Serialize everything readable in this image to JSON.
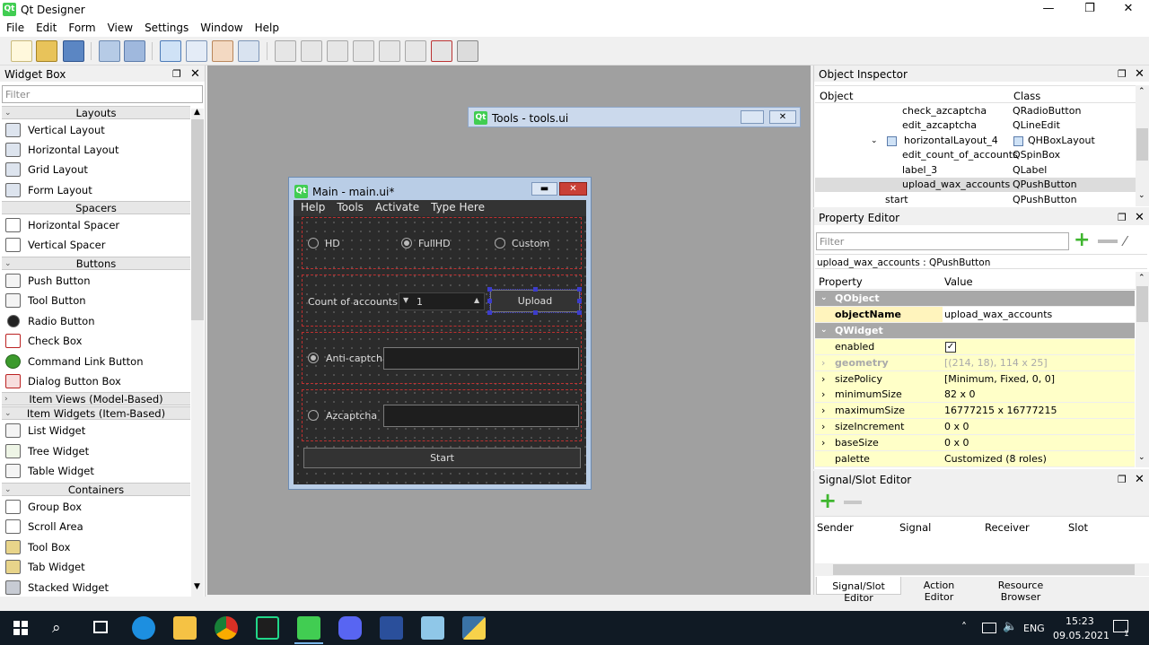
{
  "app": {
    "title": "Qt Designer",
    "logo_text": "Qt"
  },
  "window_controls": {
    "minimize": "—",
    "maximize": "❐",
    "close": "✕"
  },
  "menu": [
    "File",
    "Edit",
    "Form",
    "View",
    "Settings",
    "Window",
    "Help"
  ],
  "toolbar_icons": [
    "new-form-icon",
    "open-form-icon",
    "save-form-icon",
    "send-to-back-icon",
    "bring-to-front-icon",
    "edit-widgets-icon",
    "edit-signals-slots-icon",
    "edit-buddies-icon",
    "edit-tab-order-icon",
    "layout-horizontally-icon",
    "layout-vertically-icon",
    "layout-horizontal-splitter-icon",
    "layout-vertical-splitter-icon",
    "layout-grid-icon",
    "layout-form-icon",
    "break-layout-icon",
    "adjust-size-icon"
  ],
  "widget_box": {
    "title": "Widget Box",
    "filter_placeholder": "Filter",
    "categories": {
      "layouts": "Layouts",
      "spacers": "Spacers",
      "buttons": "Buttons",
      "item_views": "Item Views (Model-Based)",
      "item_widgets": "Item Widgets (Item-Based)",
      "containers": "Containers"
    },
    "layouts": [
      "Vertical Layout",
      "Horizontal Layout",
      "Grid Layout",
      "Form Layout"
    ],
    "spacers": [
      "Horizontal Spacer",
      "Vertical Spacer"
    ],
    "buttons": [
      "Push Button",
      "Tool Button",
      "Radio Button",
      "Check Box",
      "Command Link Button",
      "Dialog Button Box"
    ],
    "item_widgets": [
      "List Widget",
      "Tree Widget",
      "Table Widget"
    ],
    "containers": [
      "Group Box",
      "Scroll Area",
      "Tool Box",
      "Tab Widget",
      "Stacked Widget"
    ]
  },
  "tools_window": {
    "title": "Tools - tools.ui",
    "logo_text": "Qt"
  },
  "main_window": {
    "title": "Main - main.ui*",
    "logo_text": "Qt",
    "menu": [
      "Help",
      "Tools",
      "Activate",
      "Type Here"
    ],
    "radio_hd": "HD",
    "radio_fullhd": "FullHD",
    "radio_custom": "Custom",
    "count_label": "Count of accounts",
    "count_value": "1",
    "upload_button": "Upload",
    "anticaptcha_label": "Anti-captcha",
    "azcaptcha_label": "Azcaptcha",
    "start_button": "Start"
  },
  "object_inspector": {
    "title": "Object Inspector",
    "col_object": "Object",
    "col_class": "Class",
    "rows": [
      {
        "object": "check_azcaptcha",
        "class": "QRadioButton"
      },
      {
        "object": "edit_azcaptcha",
        "class": "QLineEdit"
      },
      {
        "object": "horizontalLayout_4",
        "class": "QHBoxLayout"
      },
      {
        "object": "edit_count_of_accounts",
        "class": "QSpinBox"
      },
      {
        "object": "label_3",
        "class": "QLabel"
      },
      {
        "object": "upload_wax_accounts",
        "class": "QPushButton"
      },
      {
        "object": "start",
        "class": "QPushButton"
      }
    ]
  },
  "property_editor": {
    "title": "Property Editor",
    "filter_placeholder": "Filter",
    "selected": "upload_wax_accounts : QPushButton",
    "col_property": "Property",
    "col_value": "Value",
    "rows": [
      {
        "name": "QObject",
        "value": ""
      },
      {
        "name": "objectName",
        "value": "upload_wax_accounts"
      },
      {
        "name": "QWidget",
        "value": ""
      },
      {
        "name": "enabled",
        "value": ""
      },
      {
        "name": "geometry",
        "value": "[(214, 18), 114 x 25]"
      },
      {
        "name": "sizePolicy",
        "value": "[Minimum, Fixed, 0, 0]"
      },
      {
        "name": "minimumSize",
        "value": "82 x 0"
      },
      {
        "name": "maximumSize",
        "value": "16777215 x 16777215"
      },
      {
        "name": "sizeIncrement",
        "value": "0 x 0"
      },
      {
        "name": "baseSize",
        "value": "0 x 0"
      },
      {
        "name": "palette",
        "value": "Customized (8 roles)"
      }
    ]
  },
  "signal_slot": {
    "title": "Signal/Slot Editor",
    "cols": [
      "Sender",
      "Signal",
      "Receiver",
      "Slot"
    ],
    "tabs": [
      "Signal/Slot Editor",
      "Action Editor",
      "Resource Browser"
    ]
  },
  "taskbar": {
    "lang": "ENG",
    "time": "15:23",
    "date": "09.05.2021",
    "notifications": "1",
    "apps": [
      "start-icon",
      "search-icon",
      "task-view-icon",
      "edge-icon",
      "explorer-icon",
      "chrome-icon",
      "pycharm-icon",
      "qt-designer-icon",
      "discord-icon",
      "powershell-icon",
      "notes-icon",
      "python-icon"
    ]
  },
  "colors": {
    "accent_green": "#41cd52",
    "selection": "#cce4f7",
    "group_grey": "#a8a8a8",
    "changed_yellow": "#ffffc8"
  }
}
